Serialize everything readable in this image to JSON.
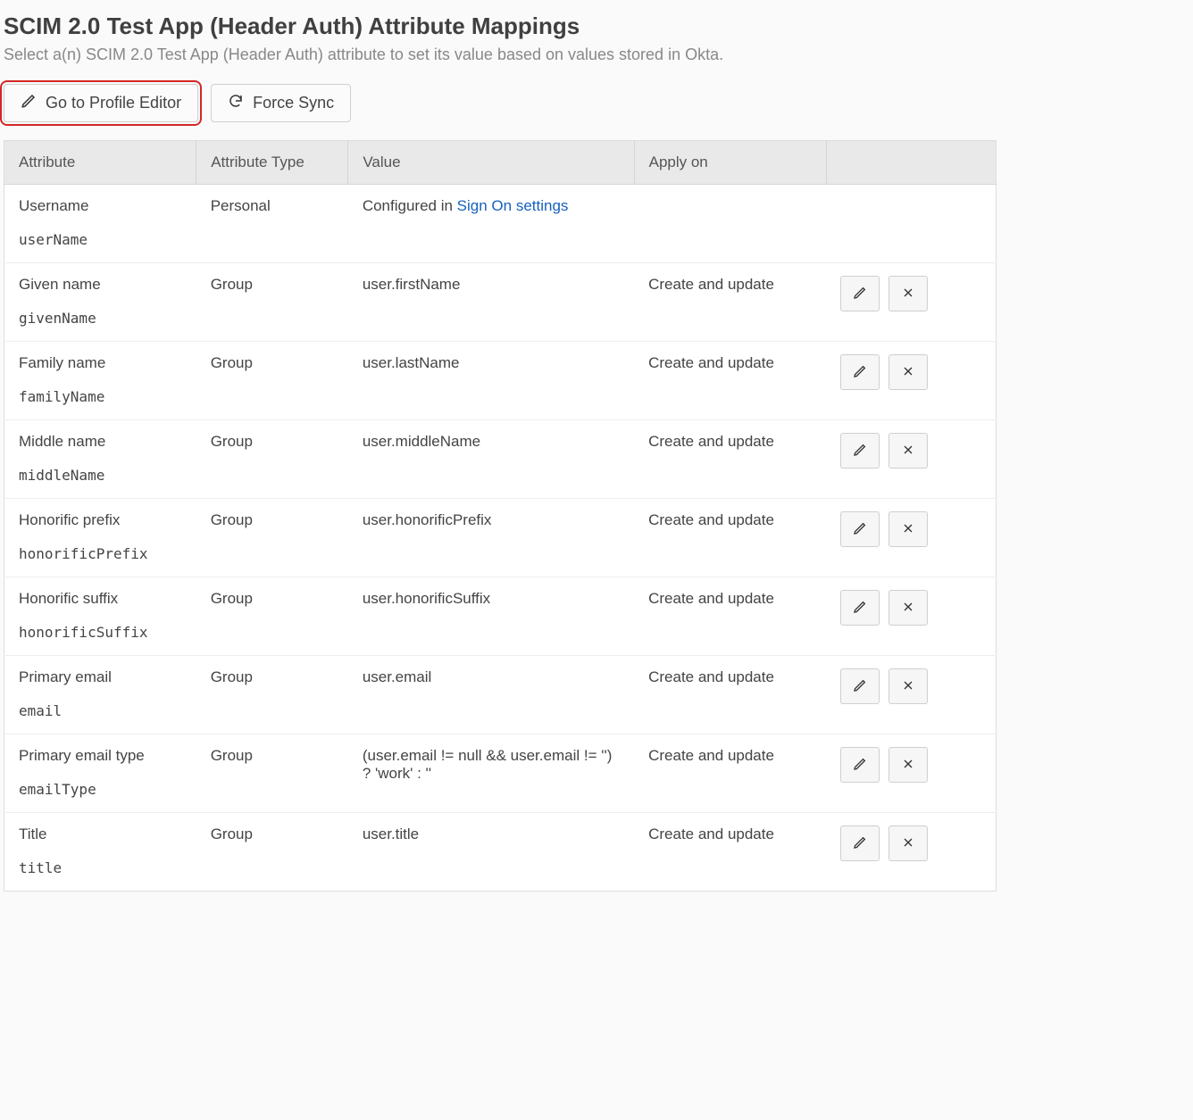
{
  "header": {
    "title": "SCIM 2.0 Test App (Header Auth) Attribute Mappings",
    "subtitle": "Select a(n) SCIM 2.0 Test App (Header Auth) attribute to set its value based on values stored in Okta."
  },
  "toolbar": {
    "profile_editor_label": "Go to Profile Editor",
    "force_sync_label": "Force Sync"
  },
  "table": {
    "columns": {
      "attribute": "Attribute",
      "attribute_type": "Attribute Type",
      "value": "Value",
      "apply_on": "Apply on"
    }
  },
  "rows": [
    {
      "display": "Username",
      "variable": "userName",
      "type": "Personal",
      "value": "",
      "value_prefix": "Configured in ",
      "value_link": "Sign On settings",
      "apply_on": "",
      "has_actions": false
    },
    {
      "display": "Given name",
      "variable": "givenName",
      "type": "Group",
      "value": "user.firstName",
      "apply_on": "Create and update",
      "has_actions": true
    },
    {
      "display": "Family name",
      "variable": "familyName",
      "type": "Group",
      "value": "user.lastName",
      "apply_on": "Create and update",
      "has_actions": true
    },
    {
      "display": "Middle name",
      "variable": "middleName",
      "type": "Group",
      "value": "user.middleName",
      "apply_on": "Create and update",
      "has_actions": true
    },
    {
      "display": "Honorific prefix",
      "variable": "honorificPrefix",
      "type": "Group",
      "value": "user.honorificPrefix",
      "apply_on": "Create and update",
      "has_actions": true
    },
    {
      "display": "Honorific suffix",
      "variable": "honorificSuffix",
      "type": "Group",
      "value": "user.honorificSuffix",
      "apply_on": "Create and update",
      "has_actions": true
    },
    {
      "display": "Primary email",
      "variable": "email",
      "type": "Group",
      "value": "user.email",
      "apply_on": "Create and update",
      "has_actions": true
    },
    {
      "display": "Primary email type",
      "variable": "emailType",
      "type": "Group",
      "value": "(user.email != null && user.email != '') ? 'work' : ''",
      "apply_on": "Create and update",
      "has_actions": true
    },
    {
      "display": "Title",
      "variable": "title",
      "type": "Group",
      "value": "user.title",
      "apply_on": "Create and update",
      "has_actions": true
    }
  ]
}
